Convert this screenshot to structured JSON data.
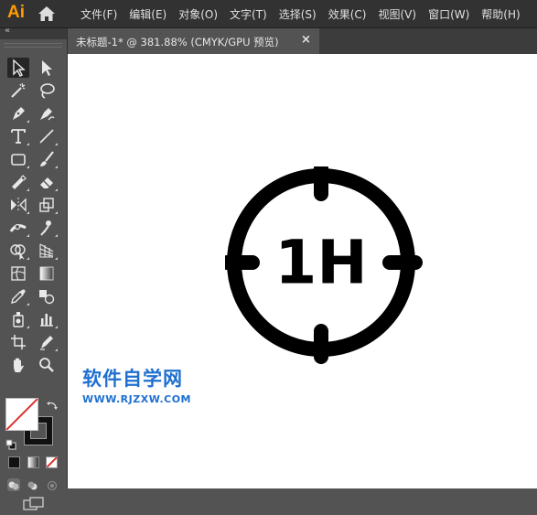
{
  "app": {
    "logo_text": "Ai",
    "logo_color": "#ff9a00",
    "home_icon": "home-icon"
  },
  "menu": [
    {
      "label": "文件(F)"
    },
    {
      "label": "编辑(E)"
    },
    {
      "label": "对象(O)"
    },
    {
      "label": "文字(T)"
    },
    {
      "label": "选择(S)"
    },
    {
      "label": "效果(C)"
    },
    {
      "label": "视图(V)"
    },
    {
      "label": "窗口(W)"
    },
    {
      "label": "帮助(H)"
    }
  ],
  "document_tab": {
    "title": "未标题-1* @ 381.88% (CMYK/GPU 预览)",
    "close_glyph": "×"
  },
  "toolbar": {
    "collapse_glyph": "«",
    "tools": [
      "selection-tool",
      "direct-selection-tool",
      "magic-wand-tool",
      "lasso-tool",
      "pen-tool",
      "curvature-tool",
      "type-tool",
      "line-segment-tool",
      "rectangle-tool",
      "paintbrush-tool",
      "shaper-tool",
      "eraser-tool",
      "reflect-tool",
      "scale-tool",
      "width-tool",
      "puppet-warp-tool",
      "shape-builder-tool",
      "perspective-grid-tool",
      "mesh-tool",
      "gradient-tool",
      "eyedropper-tool",
      "blend-tool",
      "symbol-sprayer-tool",
      "column-graph-tool",
      "artboard-tool",
      "slice-tool",
      "hand-tool",
      "zoom-tool"
    ],
    "fill_color": "#ffffff",
    "stroke_color": "#111111"
  },
  "canvas": {
    "background": "#ffffff",
    "artwork": {
      "label": "1H",
      "color": "#000000"
    },
    "watermark": {
      "title": "软件自学网",
      "url": "WWW.RJZXW.COM",
      "color": "#1e6fd0"
    }
  }
}
